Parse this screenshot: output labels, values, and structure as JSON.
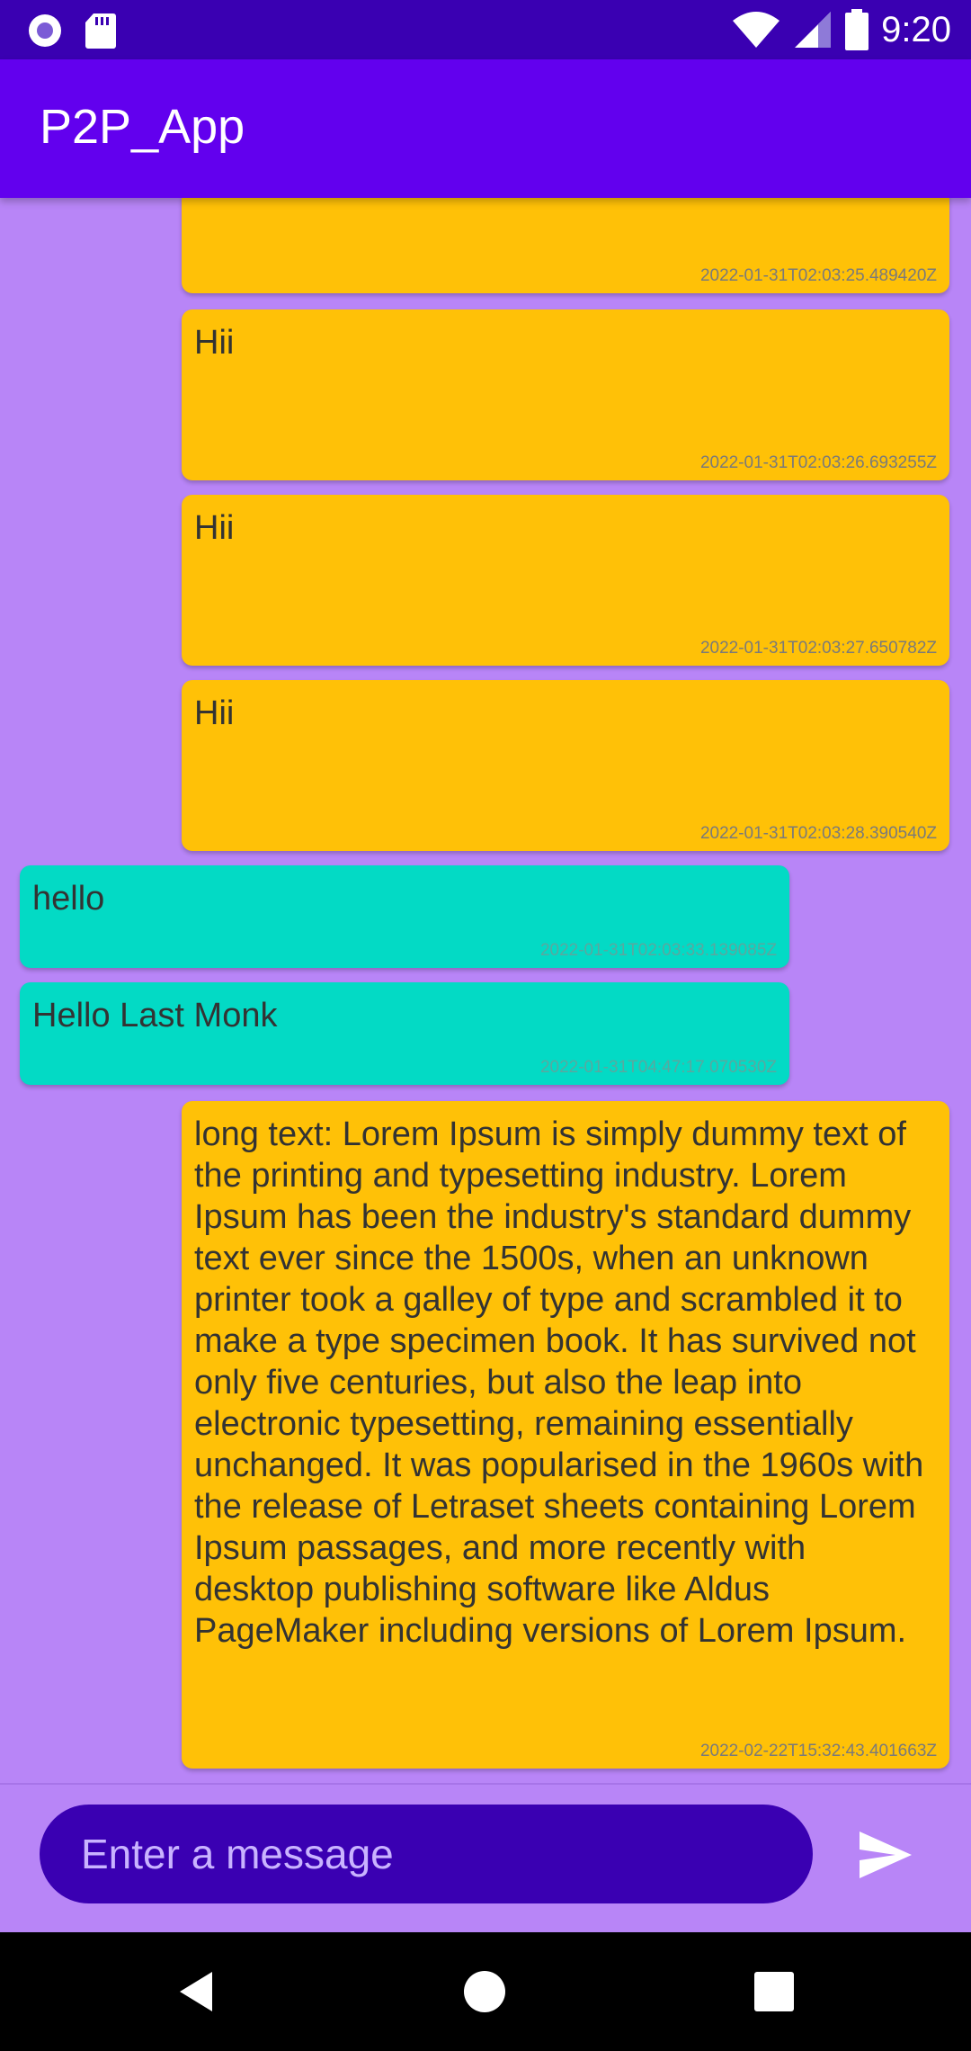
{
  "status_bar": {
    "time": "9:20",
    "icons": [
      "circle-notification-icon",
      "sd-card-icon",
      "wifi-icon",
      "signal-icon",
      "battery-icon"
    ]
  },
  "app_bar": {
    "title": "P2P_App"
  },
  "messages": [
    {
      "direction": "out",
      "text": "",
      "timestamp": "2022-01-31T02:03:25.489420Z"
    },
    {
      "direction": "out",
      "text": "Hii",
      "timestamp": "2022-01-31T02:03:26.693255Z"
    },
    {
      "direction": "out",
      "text": "Hii",
      "timestamp": "2022-01-31T02:03:27.650782Z"
    },
    {
      "direction": "out",
      "text": "Hii",
      "timestamp": "2022-01-31T02:03:28.390540Z"
    },
    {
      "direction": "in",
      "text": "hello",
      "timestamp": "2022-01-31T02:03:33.139085Z"
    },
    {
      "direction": "in",
      "text": "Hello Last Monk",
      "timestamp": "2022-01-31T04:47:17.070530Z"
    },
    {
      "direction": "out",
      "text": "long text: Lorem Ipsum is simply dummy text of the printing and typesetting industry. Lorem Ipsum has been the industry's standard dummy text ever since the 1500s, when an unknown printer took a galley of type and scrambled it to make a type specimen book. It has survived not only five centuries, but also the leap into electronic typesetting, remaining essentially unchanged. It was popularised in the 1960s with the release of Letraset sheets containing Lorem Ipsum passages, and more recently with desktop publishing software like Aldus PageMaker including versions of Lorem Ipsum.",
      "timestamp": "2022-02-22T15:32:43.401663Z"
    }
  ],
  "composer": {
    "placeholder": "Enter a message",
    "value": ""
  },
  "colors": {
    "status_bar": "#3A00B2",
    "app_bar": "#6200EE",
    "background": "#B885F7",
    "outgoing_bubble": "#FFC107",
    "incoming_bubble": "#03DAC5",
    "input_pill": "#3A00B2"
  },
  "nav_bar": {
    "icons": [
      "back-icon",
      "home-icon",
      "recents-icon"
    ]
  }
}
